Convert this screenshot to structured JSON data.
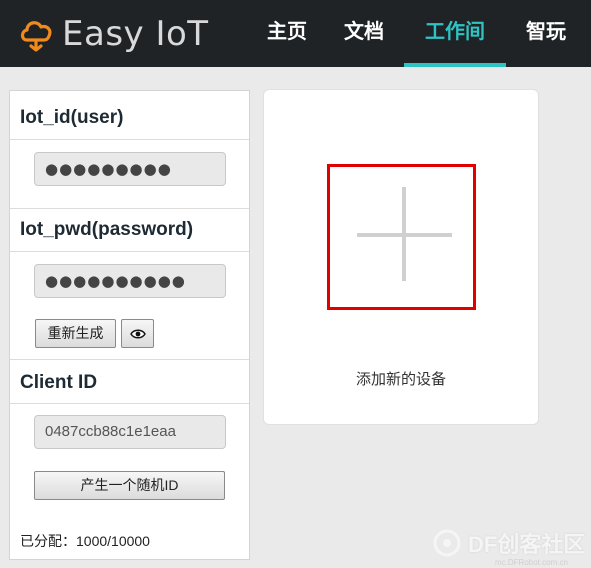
{
  "header": {
    "brand": "Easy IoT",
    "nav": [
      {
        "label": "主页"
      },
      {
        "label": "文档"
      },
      {
        "label": "工作间",
        "active": true
      },
      {
        "label": "智玩"
      }
    ],
    "accent_color": "#2ec4c4"
  },
  "sidebar": {
    "user_title": "Iot_id(user)",
    "user_value": "●●●●●●●●●",
    "pwd_title": "Iot_pwd(password)",
    "pwd_value": "●●●●●●●●●●",
    "regen_button": "重新生成",
    "show_icon": "eye-icon",
    "client_title": "Client ID",
    "client_value": "0487ccb88c1e1eaa",
    "random_button": "产生一个随机ID",
    "allocated": "已分配：1000/10000"
  },
  "main": {
    "add_device_label": "添加新的设备",
    "add_icon": "plus-icon",
    "highlight_color": "#e00000"
  },
  "watermark": {
    "text": "DF创客社区",
    "subtext": "mc.DFRobot.com.cn"
  }
}
